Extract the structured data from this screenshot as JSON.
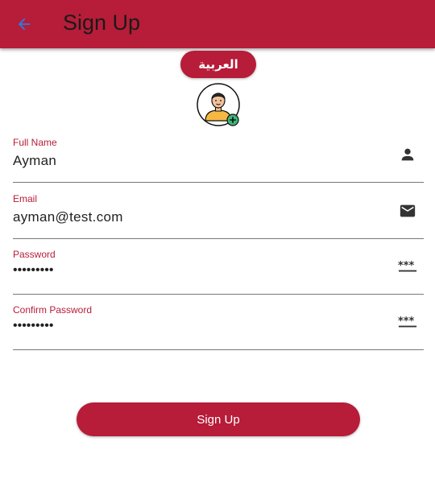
{
  "appbar": {
    "title": "Sign Up",
    "back_icon": "arrow-back-icon",
    "back_icon_color": "#2b7de0",
    "background": "#b71c38"
  },
  "language_button": {
    "label": "العربية"
  },
  "avatar": {
    "icon": "user-add-avatar-icon"
  },
  "form": {
    "full_name": {
      "label": "Full Name",
      "value": "Ayman",
      "icon": "person-icon"
    },
    "email": {
      "label": "Email",
      "value": "ayman@test.com",
      "icon": "mail-icon"
    },
    "password": {
      "label": "Password",
      "value": "•••••••••",
      "icon": "password-icon"
    },
    "confirm_password": {
      "label": "Confirm Password",
      "value": "•••••••••",
      "icon": "password-icon"
    }
  },
  "submit": {
    "label": "Sign Up"
  },
  "colors": {
    "primary": "#b71c38",
    "text": "#222222",
    "divider": "#777777"
  }
}
